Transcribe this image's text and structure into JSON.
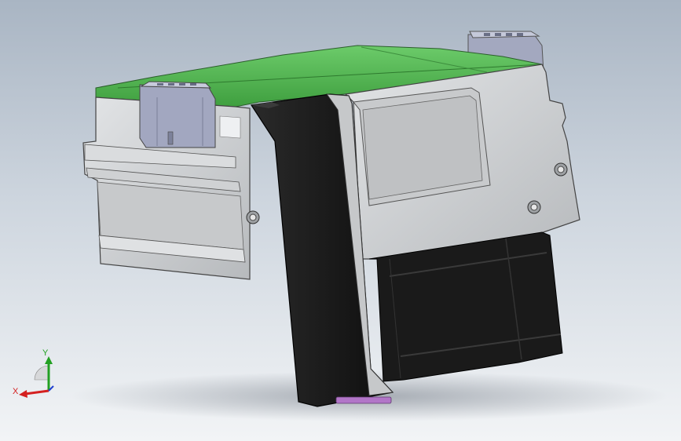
{
  "viewport": {
    "background_top": "#a9b5c3",
    "background_bottom": "#f2f4f6"
  },
  "model": {
    "top_cover_color": "#5cc05c",
    "housing_color": "#c9cbcd",
    "connector_color": "#a2a7c0",
    "block_color": "#151515",
    "pad_color": "#b276c8"
  },
  "triad": {
    "x_label": "X",
    "y_label": "Y",
    "x_color": "#d42020",
    "y_color": "#22a022",
    "z_color": "#2040d0"
  }
}
